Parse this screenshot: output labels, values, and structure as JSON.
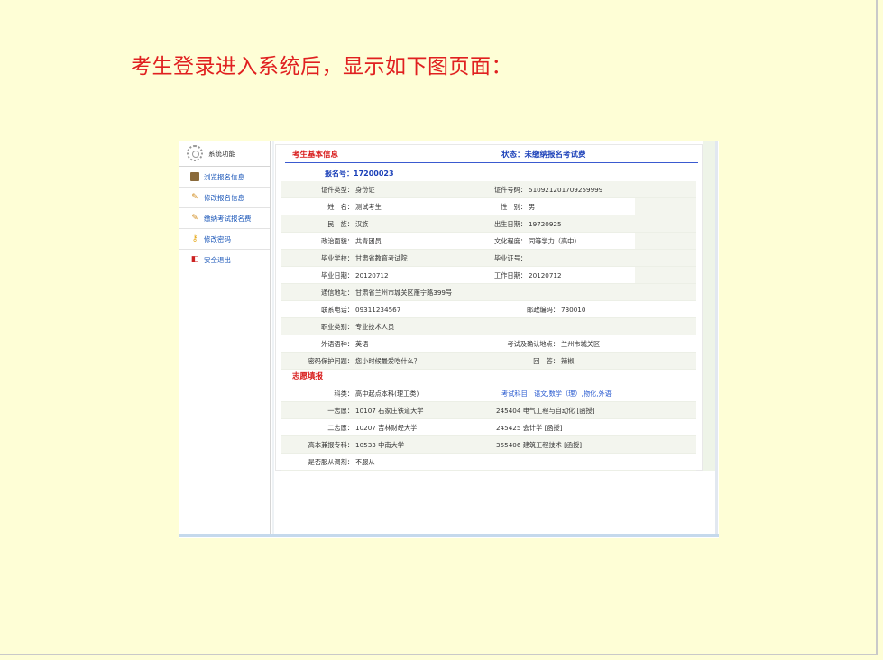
{
  "heading": "考生登录进入系统后，显示如下图页面：",
  "sidebar": {
    "title": "系统功能",
    "items": [
      {
        "label": "浏览报名信息",
        "icon": "book-icon"
      },
      {
        "label": "修改报名信息",
        "icon": "pencil-icon"
      },
      {
        "label": "缴纳考试报名费",
        "icon": "pencil-icon"
      },
      {
        "label": "修改密码",
        "icon": "key-icon"
      },
      {
        "label": "安全退出",
        "icon": "exit-door-icon"
      }
    ]
  },
  "basic": {
    "title": "考生基本信息",
    "status": "状态：未缴纳报名考试费",
    "reg_no": "报名号：17200023"
  },
  "rows": [
    {
      "l1": "证件类型：",
      "v1": "身份证",
      "l2": "证件号码：",
      "v2": "510921201709259999"
    },
    {
      "l1": "姓　名：",
      "v1": "测试考生",
      "l2": "性　别：",
      "v2": "男"
    },
    {
      "l1": "民　族：",
      "v1": "汉族",
      "l2": "出生日期：",
      "v2": "19720925"
    },
    {
      "l1": "政治面貌：",
      "v1": "共青团员",
      "l2": "文化程度：",
      "v2": "同等学力（高中）"
    },
    {
      "l1": "毕业学校：",
      "v1": "甘肃省教育考试院",
      "l2": "毕业证号：",
      "v2": ""
    },
    {
      "l1": "毕业日期：",
      "v1": "20120712",
      "l2": "工作日期：",
      "v2": "20120712"
    },
    {
      "l1": "通信地址：",
      "v1": "甘肃省兰州市城关区雁宁路399号",
      "l2": "",
      "v2": ""
    },
    {
      "l1": "联系电话：",
      "v1": "09311234567",
      "l2": "邮政编码：",
      "v2": "730010"
    },
    {
      "l1": "职业类别：",
      "v1": "专业技术人员",
      "l2": "",
      "v2": ""
    },
    {
      "l1": "外语语种：",
      "v1": "英语",
      "l2": "考试及确认地点：",
      "v2": "兰州市城关区"
    },
    {
      "l1": "密码保护问题：",
      "v1": "您小时候最爱吃什么？",
      "l2": "回　答：",
      "v2": "辣椒"
    }
  ],
  "wish": {
    "title": "志愿填报",
    "rows": [
      {
        "l1": "科类：",
        "v1": "高中起点本科(理工类)",
        "v2": "考试科目：语文,数学（理）,物化,外语"
      },
      {
        "l1": "一志愿：",
        "v1": "10107 石家庄铁道大学",
        "v2": "245404 电气工程与自动化 [函授]"
      },
      {
        "l1": "二志愿：",
        "v1": "10207 吉林财经大学",
        "v2": "245425 会计学 [函授]"
      },
      {
        "l1": "高本兼报专科：",
        "v1": "10533 中南大学",
        "v2": "355406 建筑工程技术 [函授]"
      },
      {
        "l1": "是否服从调剂：",
        "v1": "不服从",
        "v2": ""
      }
    ]
  },
  "colors": {
    "background": "#fefed6",
    "heading": "#e02020",
    "section_title": "#d81b1b",
    "status": "#1a3fb8"
  }
}
